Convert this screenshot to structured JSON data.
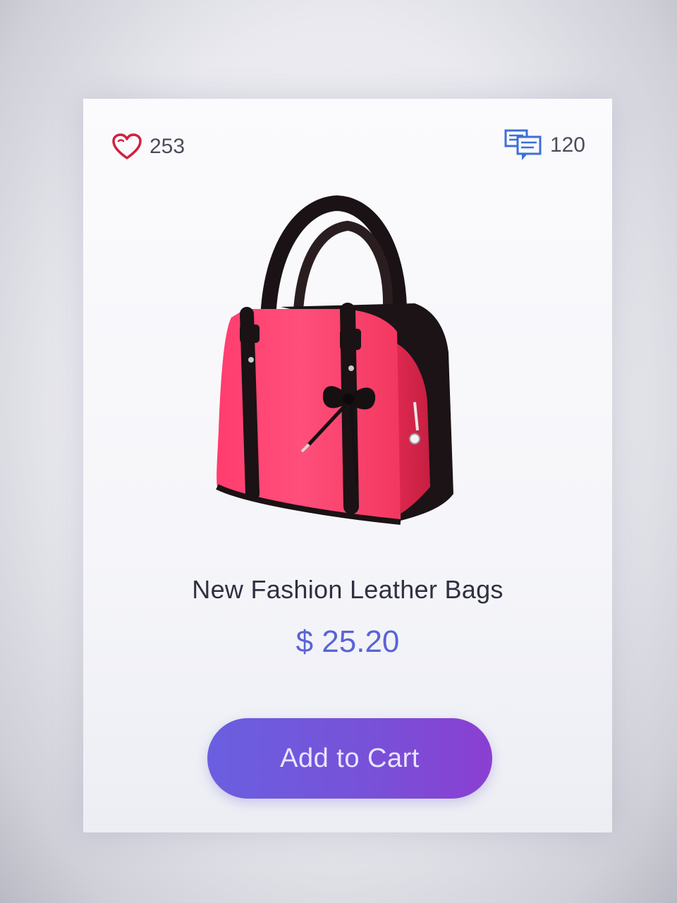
{
  "product": {
    "likes_count": "253",
    "comments_count": "120",
    "title": "New Fashion Leather Bags",
    "price": "$ 25.20",
    "image_icon": "handbag-image"
  },
  "actions": {
    "add_to_cart_label": "Add to Cart"
  },
  "colors": {
    "accent": "#6a5fe0",
    "price": "#5b63d6",
    "heart": "#d0213f",
    "comment_icon": "#3d6fd6"
  }
}
